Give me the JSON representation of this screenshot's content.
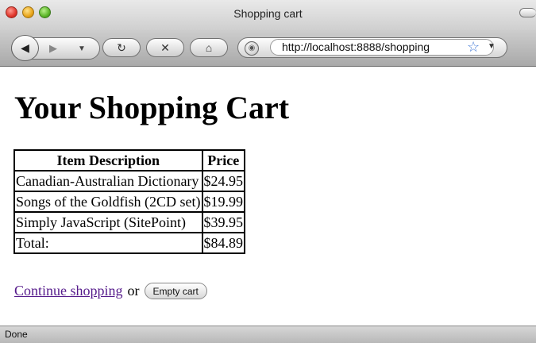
{
  "window": {
    "title": "Shopping cart",
    "url": "http://localhost:8888/shopping"
  },
  "toolbar": {
    "back_icon": "back-arrow-icon",
    "forward_icon": "forward-arrow-icon",
    "reload_icon": "reload-icon",
    "stop_icon": "stop-icon",
    "home_icon": "home-icon"
  },
  "page": {
    "heading": "Your Shopping Cart",
    "table": {
      "headers": [
        "Item Description",
        "Price"
      ],
      "rows": [
        [
          "Canadian-Australian Dictionary",
          "$24.95"
        ],
        [
          "Songs of the Goldfish (2CD set)",
          "$19.99"
        ],
        [
          "Simply JavaScript (SitePoint)",
          "$39.95"
        ]
      ],
      "total_label": "Total:",
      "total_value": "$84.89"
    },
    "continue_link": "Continue shopping",
    "or_text": "or",
    "empty_button": "Empty cart"
  },
  "status": {
    "text": "Done"
  },
  "colors": {
    "link": "#551a8b"
  }
}
